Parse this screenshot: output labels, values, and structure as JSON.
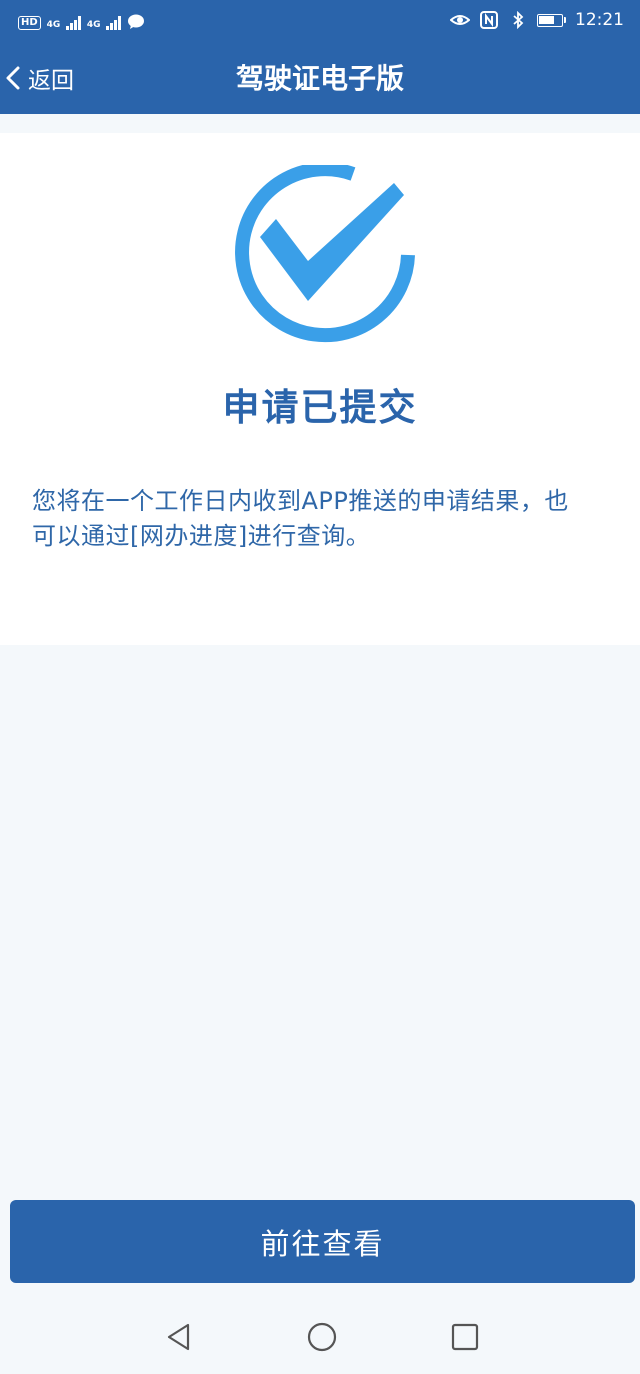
{
  "status_bar": {
    "hd": "HD",
    "net1": "4G",
    "net2": "4G",
    "time": "12:21",
    "icons": [
      "eye-icon",
      "nfc-icon",
      "bluetooth-icon",
      "battery-icon"
    ]
  },
  "nav": {
    "back_label": "返回",
    "title": "驾驶证电子版"
  },
  "result": {
    "title": "申请已提交",
    "description": "您将在一个工作日内收到APP推送的申请结果，也可以通过[网办进度]进行查询。"
  },
  "action": {
    "label": "前往查看"
  },
  "colors": {
    "brand": "#2a64ab",
    "check": "#3a9fe8",
    "background": "#f4f8fb"
  }
}
